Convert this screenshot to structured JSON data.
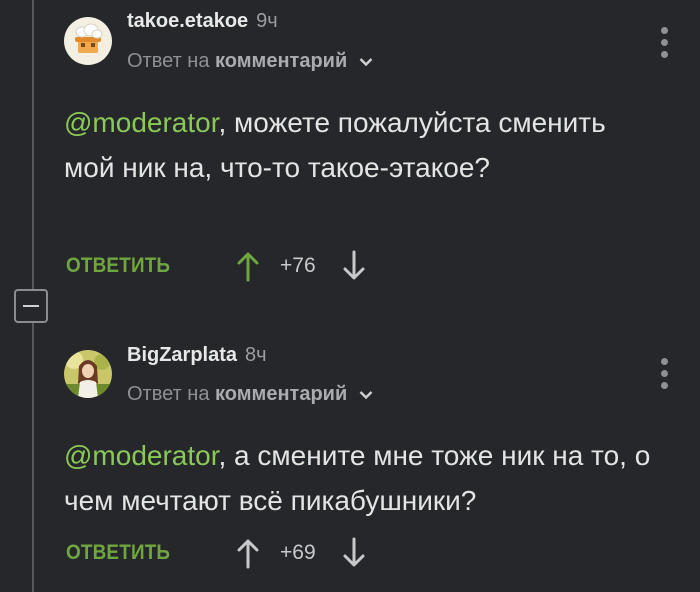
{
  "thread": {
    "collapse_icon": "minus-icon"
  },
  "comments": [
    {
      "author": "takoe.etakoe",
      "time": "9ч",
      "reply_prefix": "Ответ на",
      "reply_target": "комментарий",
      "mention": "@moderator",
      "text": ", можете пожалуйста сменить мой ник на, что-то такое-этакое?",
      "reply_label": "ОТВЕТИТЬ",
      "votes": "+76",
      "upvote_active": true
    },
    {
      "author": "BigZarplata",
      "time": "8ч",
      "reply_prefix": "Ответ на",
      "reply_target": "комментарий",
      "mention": "@moderator",
      "text": ", а смените мне тоже ник на то, о чем мечтают всё пикабушники?",
      "reply_label": "ОТВЕТИТЬ",
      "votes": "+69",
      "upvote_active": false
    }
  ],
  "colors": {
    "background": "#25272a",
    "mention": "#8ac858",
    "reply_button": "#6fa640",
    "upvote_active": "#6fa640",
    "icon_muted": "#c8c9cb"
  }
}
